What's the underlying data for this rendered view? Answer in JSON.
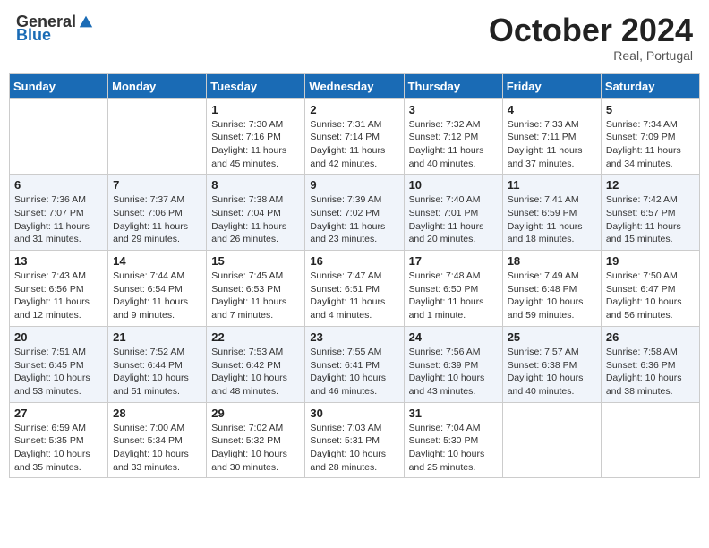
{
  "header": {
    "logo_general": "General",
    "logo_blue": "Blue",
    "month_title": "October 2024",
    "location": "Real, Portugal"
  },
  "days_of_week": [
    "Sunday",
    "Monday",
    "Tuesday",
    "Wednesday",
    "Thursday",
    "Friday",
    "Saturday"
  ],
  "weeks": [
    [
      {
        "day": "",
        "sunrise": "",
        "sunset": "",
        "daylight": ""
      },
      {
        "day": "",
        "sunrise": "",
        "sunset": "",
        "daylight": ""
      },
      {
        "day": "1",
        "sunrise": "Sunrise: 7:30 AM",
        "sunset": "Sunset: 7:16 PM",
        "daylight": "Daylight: 11 hours and 45 minutes."
      },
      {
        "day": "2",
        "sunrise": "Sunrise: 7:31 AM",
        "sunset": "Sunset: 7:14 PM",
        "daylight": "Daylight: 11 hours and 42 minutes."
      },
      {
        "day": "3",
        "sunrise": "Sunrise: 7:32 AM",
        "sunset": "Sunset: 7:12 PM",
        "daylight": "Daylight: 11 hours and 40 minutes."
      },
      {
        "day": "4",
        "sunrise": "Sunrise: 7:33 AM",
        "sunset": "Sunset: 7:11 PM",
        "daylight": "Daylight: 11 hours and 37 minutes."
      },
      {
        "day": "5",
        "sunrise": "Sunrise: 7:34 AM",
        "sunset": "Sunset: 7:09 PM",
        "daylight": "Daylight: 11 hours and 34 minutes."
      }
    ],
    [
      {
        "day": "6",
        "sunrise": "Sunrise: 7:36 AM",
        "sunset": "Sunset: 7:07 PM",
        "daylight": "Daylight: 11 hours and 31 minutes."
      },
      {
        "day": "7",
        "sunrise": "Sunrise: 7:37 AM",
        "sunset": "Sunset: 7:06 PM",
        "daylight": "Daylight: 11 hours and 29 minutes."
      },
      {
        "day": "8",
        "sunrise": "Sunrise: 7:38 AM",
        "sunset": "Sunset: 7:04 PM",
        "daylight": "Daylight: 11 hours and 26 minutes."
      },
      {
        "day": "9",
        "sunrise": "Sunrise: 7:39 AM",
        "sunset": "Sunset: 7:02 PM",
        "daylight": "Daylight: 11 hours and 23 minutes."
      },
      {
        "day": "10",
        "sunrise": "Sunrise: 7:40 AM",
        "sunset": "Sunset: 7:01 PM",
        "daylight": "Daylight: 11 hours and 20 minutes."
      },
      {
        "day": "11",
        "sunrise": "Sunrise: 7:41 AM",
        "sunset": "Sunset: 6:59 PM",
        "daylight": "Daylight: 11 hours and 18 minutes."
      },
      {
        "day": "12",
        "sunrise": "Sunrise: 7:42 AM",
        "sunset": "Sunset: 6:57 PM",
        "daylight": "Daylight: 11 hours and 15 minutes."
      }
    ],
    [
      {
        "day": "13",
        "sunrise": "Sunrise: 7:43 AM",
        "sunset": "Sunset: 6:56 PM",
        "daylight": "Daylight: 11 hours and 12 minutes."
      },
      {
        "day": "14",
        "sunrise": "Sunrise: 7:44 AM",
        "sunset": "Sunset: 6:54 PM",
        "daylight": "Daylight: 11 hours and 9 minutes."
      },
      {
        "day": "15",
        "sunrise": "Sunrise: 7:45 AM",
        "sunset": "Sunset: 6:53 PM",
        "daylight": "Daylight: 11 hours and 7 minutes."
      },
      {
        "day": "16",
        "sunrise": "Sunrise: 7:47 AM",
        "sunset": "Sunset: 6:51 PM",
        "daylight": "Daylight: 11 hours and 4 minutes."
      },
      {
        "day": "17",
        "sunrise": "Sunrise: 7:48 AM",
        "sunset": "Sunset: 6:50 PM",
        "daylight": "Daylight: 11 hours and 1 minute."
      },
      {
        "day": "18",
        "sunrise": "Sunrise: 7:49 AM",
        "sunset": "Sunset: 6:48 PM",
        "daylight": "Daylight: 10 hours and 59 minutes."
      },
      {
        "day": "19",
        "sunrise": "Sunrise: 7:50 AM",
        "sunset": "Sunset: 6:47 PM",
        "daylight": "Daylight: 10 hours and 56 minutes."
      }
    ],
    [
      {
        "day": "20",
        "sunrise": "Sunrise: 7:51 AM",
        "sunset": "Sunset: 6:45 PM",
        "daylight": "Daylight: 10 hours and 53 minutes."
      },
      {
        "day": "21",
        "sunrise": "Sunrise: 7:52 AM",
        "sunset": "Sunset: 6:44 PM",
        "daylight": "Daylight: 10 hours and 51 minutes."
      },
      {
        "day": "22",
        "sunrise": "Sunrise: 7:53 AM",
        "sunset": "Sunset: 6:42 PM",
        "daylight": "Daylight: 10 hours and 48 minutes."
      },
      {
        "day": "23",
        "sunrise": "Sunrise: 7:55 AM",
        "sunset": "Sunset: 6:41 PM",
        "daylight": "Daylight: 10 hours and 46 minutes."
      },
      {
        "day": "24",
        "sunrise": "Sunrise: 7:56 AM",
        "sunset": "Sunset: 6:39 PM",
        "daylight": "Daylight: 10 hours and 43 minutes."
      },
      {
        "day": "25",
        "sunrise": "Sunrise: 7:57 AM",
        "sunset": "Sunset: 6:38 PM",
        "daylight": "Daylight: 10 hours and 40 minutes."
      },
      {
        "day": "26",
        "sunrise": "Sunrise: 7:58 AM",
        "sunset": "Sunset: 6:36 PM",
        "daylight": "Daylight: 10 hours and 38 minutes."
      }
    ],
    [
      {
        "day": "27",
        "sunrise": "Sunrise: 6:59 AM",
        "sunset": "Sunset: 5:35 PM",
        "daylight": "Daylight: 10 hours and 35 minutes."
      },
      {
        "day": "28",
        "sunrise": "Sunrise: 7:00 AM",
        "sunset": "Sunset: 5:34 PM",
        "daylight": "Daylight: 10 hours and 33 minutes."
      },
      {
        "day": "29",
        "sunrise": "Sunrise: 7:02 AM",
        "sunset": "Sunset: 5:32 PM",
        "daylight": "Daylight: 10 hours and 30 minutes."
      },
      {
        "day": "30",
        "sunrise": "Sunrise: 7:03 AM",
        "sunset": "Sunset: 5:31 PM",
        "daylight": "Daylight: 10 hours and 28 minutes."
      },
      {
        "day": "31",
        "sunrise": "Sunrise: 7:04 AM",
        "sunset": "Sunset: 5:30 PM",
        "daylight": "Daylight: 10 hours and 25 minutes."
      },
      {
        "day": "",
        "sunrise": "",
        "sunset": "",
        "daylight": ""
      },
      {
        "day": "",
        "sunrise": "",
        "sunset": "",
        "daylight": ""
      }
    ]
  ]
}
